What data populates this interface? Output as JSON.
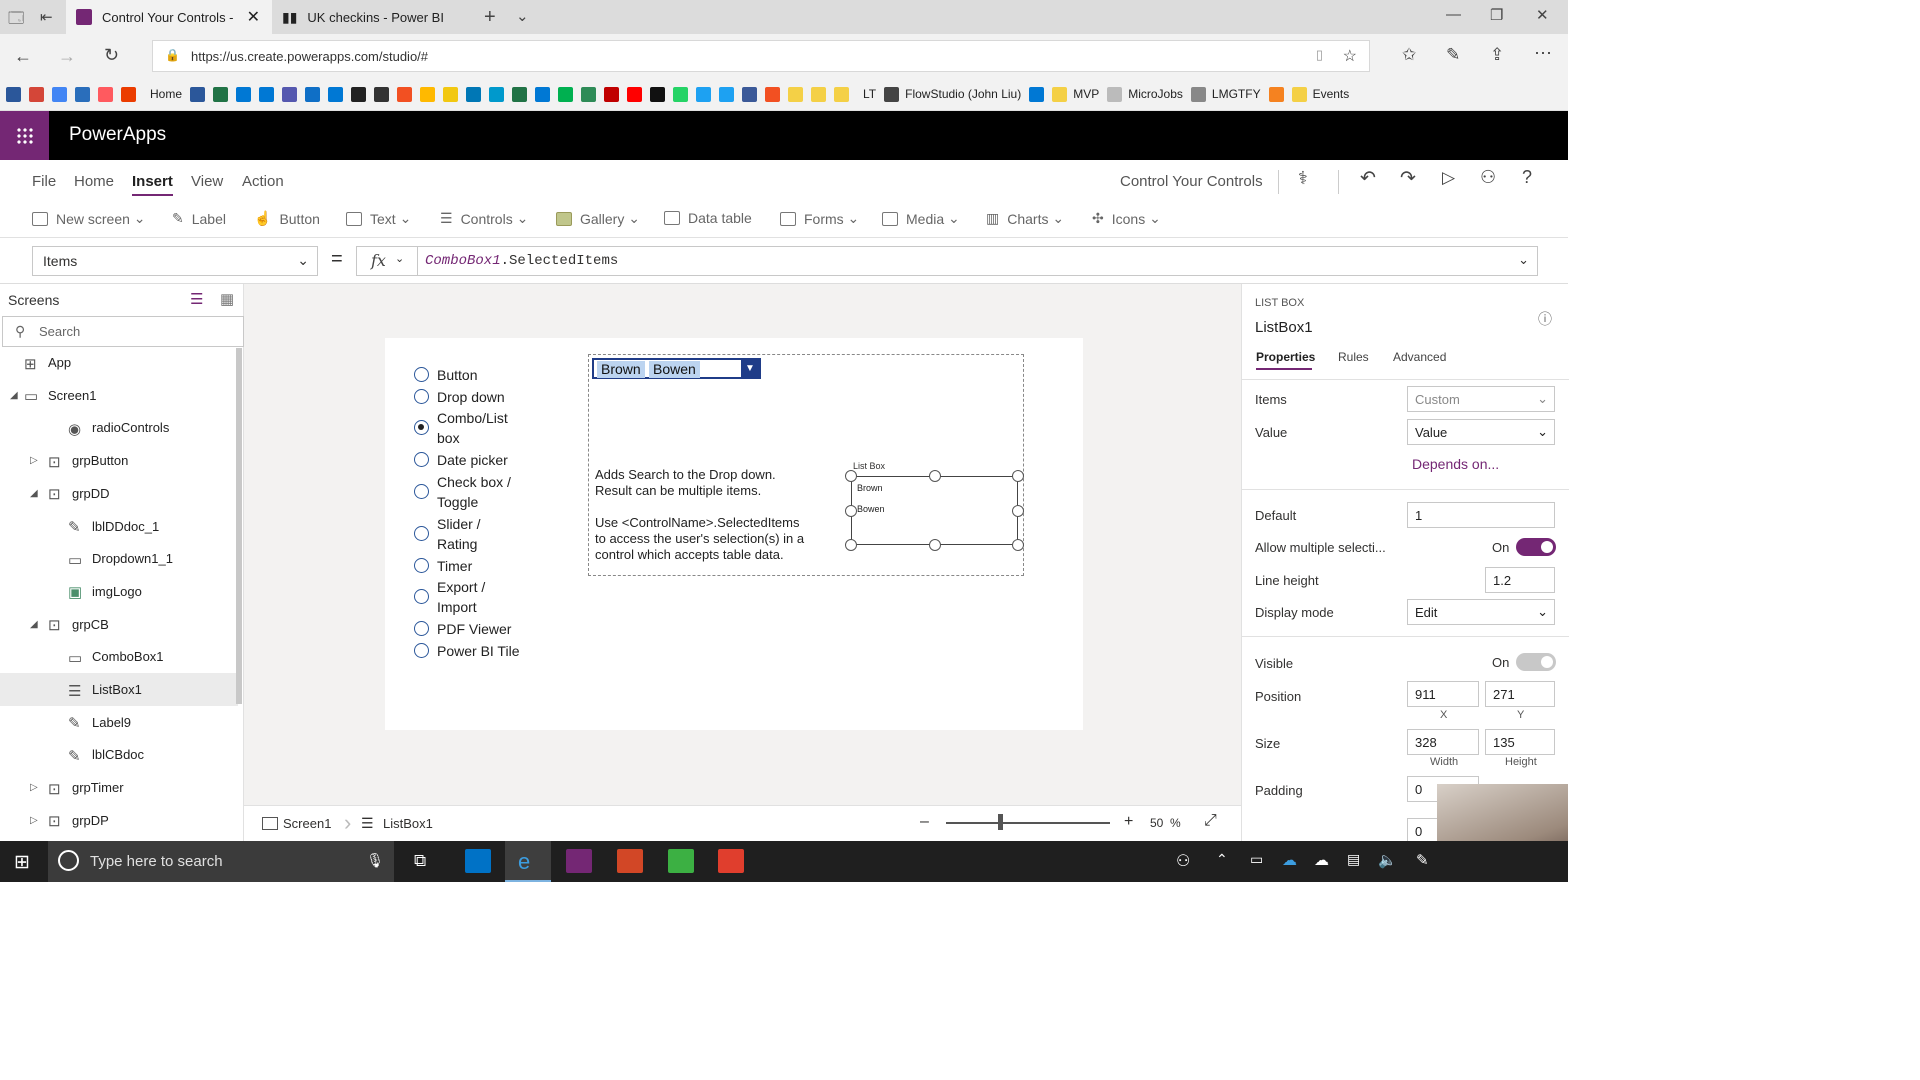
{
  "browser": {
    "tabs": [
      {
        "title": "Control Your Controls -",
        "active": true,
        "icon_color": "#742774"
      },
      {
        "title": "UK checkins - Power BI",
        "active": false,
        "icon_color": "#333333"
      }
    ],
    "url": "https://us.create.powerapps.com/studio/#",
    "favorites": [
      "Home",
      "LT",
      "FlowStudio (John Liu)",
      "MVP",
      "MicroJobs",
      "LMGTFY",
      "Events"
    ]
  },
  "app": {
    "brand": "PowerApps",
    "menu": [
      "File",
      "Home",
      "Insert",
      "View",
      "Action"
    ],
    "active_menu": "Insert",
    "app_name": "Control Your Controls",
    "ribbon": [
      "New screen",
      "Label",
      "Button",
      "Text",
      "Controls",
      "Gallery",
      "Data table",
      "Forms",
      "Media",
      "Charts",
      "Icons"
    ]
  },
  "formula": {
    "property": "Items",
    "equals": "=",
    "fx": "fx",
    "control": "ComboBox1",
    "expr": ".SelectedItems"
  },
  "screens_panel": {
    "title": "Screens",
    "search_placeholder": "Search",
    "tree": [
      {
        "label": "App",
        "icon": "app-icon",
        "indent": 0,
        "expander": ""
      },
      {
        "label": "Screen1",
        "icon": "screen-icon",
        "indent": 0,
        "expander": "◢"
      },
      {
        "label": "radioControls",
        "icon": "radio-icon",
        "indent": 2,
        "expander": ""
      },
      {
        "label": "grpButton",
        "icon": "group-icon",
        "indent": 1,
        "expander": "▷"
      },
      {
        "label": "grpDD",
        "icon": "group-icon",
        "indent": 1,
        "expander": "◢"
      },
      {
        "label": "lblDDdoc_1",
        "icon": "label-icon",
        "indent": 2,
        "expander": ""
      },
      {
        "label": "Dropdown1_1",
        "icon": "dropdown-icon",
        "indent": 2,
        "expander": ""
      },
      {
        "label": "imgLogo",
        "icon": "image-icon",
        "indent": 2,
        "expander": ""
      },
      {
        "label": "grpCB",
        "icon": "group-icon",
        "indent": 1,
        "expander": "◢"
      },
      {
        "label": "ComboBox1",
        "icon": "combobox-icon",
        "indent": 2,
        "expander": ""
      },
      {
        "label": "ListBox1",
        "icon": "listbox-icon",
        "indent": 2,
        "expander": "",
        "selected": true
      },
      {
        "label": "Label9",
        "icon": "label-icon",
        "indent": 2,
        "expander": ""
      },
      {
        "label": "lblCBdoc",
        "icon": "label-icon",
        "indent": 2,
        "expander": ""
      },
      {
        "label": "grpTimer",
        "icon": "group-icon",
        "indent": 1,
        "expander": "▷"
      },
      {
        "label": "grpDP",
        "icon": "group-icon",
        "indent": 1,
        "expander": "▷"
      }
    ]
  },
  "canvas": {
    "radios": [
      {
        "lines": [
          "Button"
        ],
        "checked": false
      },
      {
        "lines": [
          "Drop down"
        ],
        "checked": false
      },
      {
        "lines": [
          "Combo/List",
          "box"
        ],
        "checked": true
      },
      {
        "lines": [
          "Date picker"
        ],
        "checked": false
      },
      {
        "lines": [
          "Check box /",
          "Toggle"
        ],
        "checked": false
      },
      {
        "lines": [
          "Slider /",
          "Rating"
        ],
        "checked": false
      },
      {
        "lines": [
          "Timer"
        ],
        "checked": false
      },
      {
        "lines": [
          "Export /",
          "Import"
        ],
        "checked": false
      },
      {
        "lines": [
          "PDF Viewer"
        ],
        "checked": false
      },
      {
        "lines": [
          "Power BI Tile"
        ],
        "checked": false
      }
    ],
    "combo_chips": [
      "Brown",
      "Bowen"
    ],
    "description_lines": [
      "Adds Search to the Drop down.",
      "Result can be multiple items.",
      "",
      "Use <ControlName>.SelectedItems",
      "to access the user's selection(s) in a",
      "control which accepts table data."
    ],
    "listbox_title": "List Box",
    "listbox_items": [
      "Brown",
      "Bowen"
    ]
  },
  "status": {
    "screen": "Screen1",
    "control": "ListBox1",
    "zoom": "50",
    "zoom_unit": "%",
    "zoom_fraction": 0.33
  },
  "properties_panel": {
    "type": "LIST BOX",
    "name": "ListBox1",
    "tabs": [
      "Properties",
      "Rules",
      "Advanced"
    ],
    "active_tab": "Properties",
    "items_label": "Items",
    "items_value": "Custom",
    "value_label": "Value",
    "value_value": "Value",
    "depends": "Depends on...",
    "default_label": "Default",
    "default_value": "1",
    "multi_label": "Allow multiple selecti...",
    "multi_state": "On",
    "lineheight_label": "Line height",
    "lineheight_value": "1.2",
    "displaymode_label": "Display mode",
    "displaymode_value": "Edit",
    "visible_label": "Visible",
    "visible_state": "On",
    "position_label": "Position",
    "pos_x": "911",
    "pos_y": "271",
    "x_label": "X",
    "y_label": "Y",
    "size_label": "Size",
    "width": "328",
    "height": "135",
    "width_label": "Width",
    "height_label": "Height",
    "padding_label": "Padding",
    "padding_top": "0",
    "padding_bottom": "0",
    "accent": "#742774"
  },
  "taskbar": {
    "search_placeholder": "Type here to search"
  }
}
